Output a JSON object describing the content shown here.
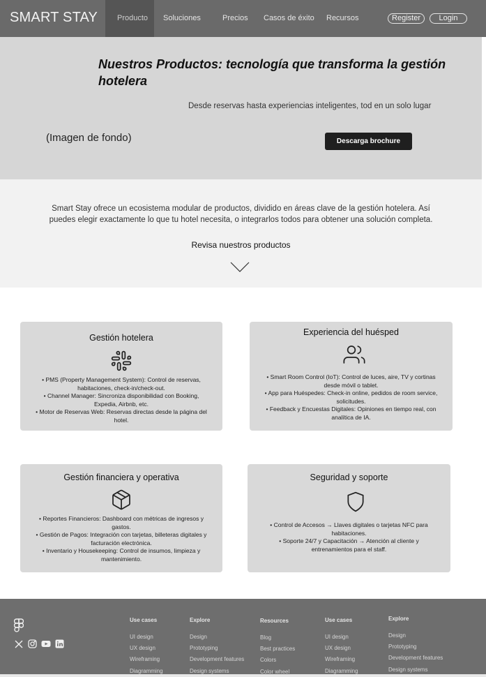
{
  "nav": {
    "brand": "SMART STAY",
    "links": [
      "Producto",
      "Soluciones",
      "Precios",
      "Casos de éxito",
      "Recursos"
    ],
    "register": "Register",
    "login": "Login"
  },
  "hero": {
    "title": "Nuestros Productos: tecnología que transforma la gestión hotelera",
    "subtitle": "Desde reservas hasta experiencias inteligentes, tod en un solo lugar",
    "image_placeholder": "(Imagen de fondo)",
    "cta": "Descarga brochure"
  },
  "intro": {
    "text": "Smart Stay ofrece un ecosistema modular de productos, dividido en áreas clave de la gestión hotelera. Así puedes elegir exactamente lo que tu hotel necesita, o integrarlos todos para obtener una solución completa.",
    "link": "Revisa nuestros productos"
  },
  "cards": [
    {
      "title": "Gestión hotelera",
      "icon": "slack-icon",
      "items": [
        "• PMS (Property Management System): Control de reservas, habitaciones, check-in/check-out.",
        "• Channel Manager: Sincroniza disponibilidad con Booking, Expedia, Airbnb, etc.",
        "• Motor de Reservas Web: Reservas directas desde la página del hotel."
      ]
    },
    {
      "title": "Experiencia del huésped",
      "icon": "users-icon",
      "items": [
        "• Smart Room Control (IoT): Control de luces, aire, TV y cortinas desde móvil o tablet.",
        "• App para Huéspedes: Check-in online, pedidos de room service, solicitudes.",
        "• Feedback y Encuestas Digitales:  Opiniones en tiempo real, con analítica de IA."
      ]
    },
    {
      "title": "Gestión financiera y operativa",
      "icon": "box-icon",
      "items": [
        "• Reportes Financieros: Dashboard con métricas de ingresos y gastos.",
        "• Gestión de Pagos: Integración con tarjetas, billeteras digitales y facturación electrónica.",
        "• Inventario y Housekeeping: Control de insumos, limpieza y mantenimiento."
      ]
    },
    {
      "title": "Seguridad y soporte",
      "icon": "shield-icon",
      "items": [
        "• Control de Accesos → Llaves digitales o tarjetas NFC para habitaciones.",
        "• Soporte 24/7 y Capacitación → Atención al cliente y entrenamientos para el staff."
      ]
    }
  ],
  "footer": {
    "social_icons": [
      "figma-icon",
      "x-icon",
      "instagram-icon",
      "youtube-icon",
      "linkedin-icon"
    ],
    "columns": [
      {
        "heading": "Use cases",
        "links": [
          "UI design",
          "UX design",
          "Wireframing",
          "Diagramming"
        ]
      },
      {
        "heading": "Explore",
        "links": [
          "Design",
          "Prototyping",
          "Development features",
          "Design systems"
        ]
      },
      {
        "heading": "Resources",
        "links": [
          "Blog",
          "Best practices",
          "Colors",
          "Color wheel"
        ]
      },
      {
        "heading": "Use cases",
        "links": [
          "UI design",
          "UX design",
          "Wireframing",
          "Diagramming"
        ]
      },
      {
        "heading": "Explore",
        "links": [
          "Design",
          "Prototyping",
          "Development features",
          "Design systems"
        ]
      }
    ]
  }
}
